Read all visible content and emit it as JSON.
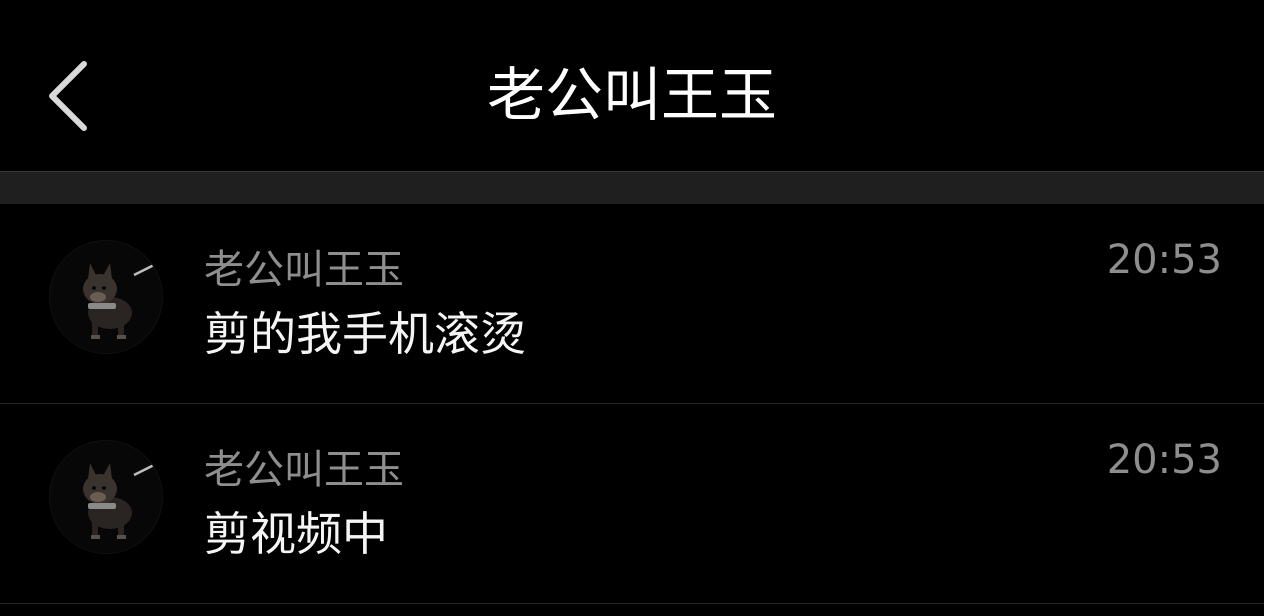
{
  "header": {
    "back_icon": "chevron-left-icon",
    "title": "老公叫王玉"
  },
  "messages": [
    {
      "sender": "老公叫王玉",
      "text": "剪的我手机滚烫",
      "time": "20:53",
      "avatar_icon": "dog-avatar"
    },
    {
      "sender": "老公叫王玉",
      "text": "剪视频中",
      "time": "20:53",
      "avatar_icon": "dog-avatar"
    }
  ]
}
